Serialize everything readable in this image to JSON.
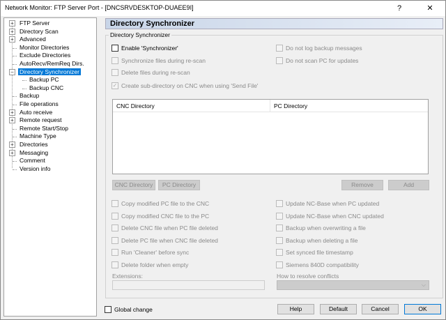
{
  "window": {
    "title": "Network Monitor: FTP Server Port - [DNCSRVDESKTOP-DUAEE9I]",
    "help_btn": "?",
    "close_btn": "✕"
  },
  "tree": [
    {
      "label": "FTP Server",
      "level": 0,
      "expander": "+"
    },
    {
      "label": "Directory Scan",
      "level": 0,
      "expander": "+"
    },
    {
      "label": "Advanced",
      "level": 0,
      "expander": "+"
    },
    {
      "label": "Monitor Directories",
      "level": 0,
      "expander": ""
    },
    {
      "label": "Exclude Directories",
      "level": 0,
      "expander": ""
    },
    {
      "label": "AutoRecv/RemReq Dirs.",
      "level": 0,
      "expander": ""
    },
    {
      "label": "Directory Synchronizer",
      "level": 0,
      "expander": "−",
      "selected": true
    },
    {
      "label": "Backup PC",
      "level": 1,
      "expander": ""
    },
    {
      "label": "Backup CNC",
      "level": 1,
      "expander": ""
    },
    {
      "label": "Backup",
      "level": 0,
      "expander": ""
    },
    {
      "label": "File operations",
      "level": 0,
      "expander": ""
    },
    {
      "label": "Auto receive",
      "level": 0,
      "expander": "+"
    },
    {
      "label": "Remote request",
      "level": 0,
      "expander": "+"
    },
    {
      "label": "Remote Start/Stop",
      "level": 0,
      "expander": ""
    },
    {
      "label": "Machine Type",
      "level": 0,
      "expander": ""
    },
    {
      "label": "Directories",
      "level": 0,
      "expander": "+"
    },
    {
      "label": "Messaging",
      "level": 0,
      "expander": "+"
    },
    {
      "label": "Comment",
      "level": 0,
      "expander": ""
    },
    {
      "label": "Version info",
      "level": 0,
      "expander": ""
    }
  ],
  "header": {
    "title": "Directory Synchronizer"
  },
  "group": {
    "title": "Directory Synchronizer"
  },
  "top_checks": {
    "enable_sync": "Enable 'Synchronizer'",
    "sync_rescan": "Synchronize files during re-scan",
    "delete_rescan": "Delete files during re-scan",
    "create_subdir": "Create sub-directory on CNC when using 'Send File'",
    "no_log_backup": "Do not log backup messages",
    "no_scan_pc": "Do not scan PC for updates"
  },
  "list": {
    "col_cnc": "CNC Directory",
    "col_pc": "PC Directory"
  },
  "list_buttons": {
    "cnc_dir": "CNC Directory",
    "pc_dir": "PC Directory",
    "remove": "Remove",
    "add": "Add"
  },
  "options_left": [
    "Copy modified PC file to the CNC",
    "Copy modified CNC file to the PC",
    "Delete CNC file when PC file deleted",
    "Delete PC file when CNC file deleted",
    "Run 'Cleaner' before sync",
    "Delete folder when empty"
  ],
  "options_right": [
    "Update NC-Base when PC updated",
    "Update NC-Base when CNC updated",
    "Backup when overwriting a file",
    "Backup when deleting a file",
    "Set synced file timestamp",
    "Siemens 840D compatibility"
  ],
  "extensions": {
    "label": "Extensions:",
    "value": ""
  },
  "conflicts": {
    "label": "How to resolve conflicts",
    "value": ""
  },
  "footer": {
    "global_change": "Global change",
    "help": "Help",
    "default": "Default",
    "cancel": "Cancel",
    "ok": "OK"
  }
}
